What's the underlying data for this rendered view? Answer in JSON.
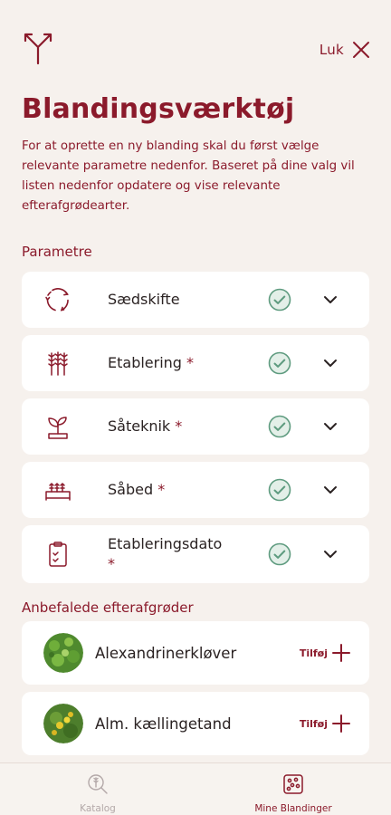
{
  "header": {
    "close_label": "Luk"
  },
  "title": "Blandingsværktøj",
  "intro": "For at oprette en ny blanding skal du først vælge relevante parametre nedenfor. Baseret på dine valg vil listen nedenfor opdatere og vise relevante efterafgrødearter.",
  "parameters_heading": "Parametre",
  "parameters": [
    {
      "label": "Sædskifte",
      "required": "",
      "icon": "rotation-icon",
      "checked": true
    },
    {
      "label": "Etablering",
      "required": "*",
      "icon": "wheat-icon",
      "checked": true
    },
    {
      "label": "Såteknik",
      "required": "*",
      "icon": "seedling-icon",
      "checked": true
    },
    {
      "label": "Såbed",
      "required": "*",
      "icon": "seedbed-icon",
      "checked": true
    },
    {
      "label": "Etableringsdato",
      "required": "*",
      "icon": "clipboard-icon",
      "checked": true
    }
  ],
  "recommended_heading": "Anbefalede efterafgrøder",
  "recommended": [
    {
      "name": "Alexandrinerkløver",
      "add_label": "Tilføj"
    },
    {
      "name": "Alm. kællingetand",
      "add_label": "Tilføj"
    }
  ],
  "tabs": [
    {
      "label": "Katalog",
      "active": false
    },
    {
      "label": "Mine Blandinger",
      "active": true
    }
  ],
  "colors": {
    "accent": "#8b1a2b",
    "check": "#5e9b7f",
    "background": "#f6f1ed"
  }
}
